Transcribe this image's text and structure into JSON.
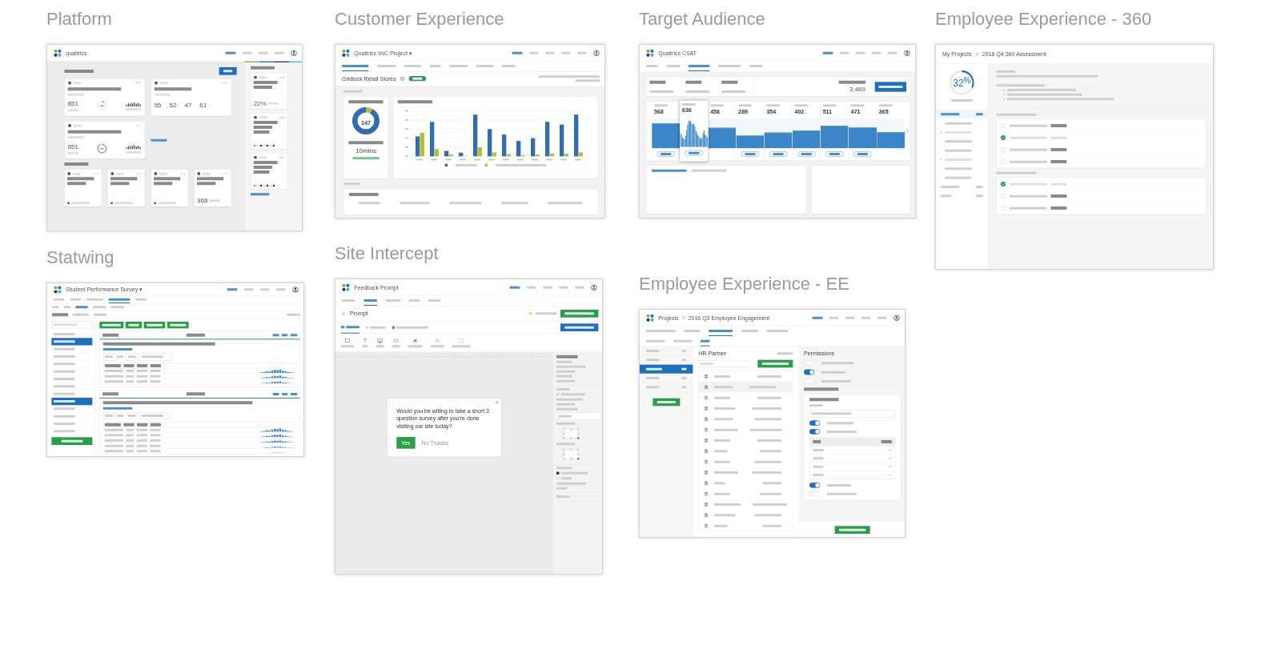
{
  "sections": [
    {
      "title": "Platform",
      "screen": {
        "kind": "platform",
        "brand": "qualtrics",
        "recent": [
          {
            "kind": "summary",
            "stat": "851"
          },
          {
            "kind": "scores",
            "scores": [
              "55",
              "52",
              "47",
              "61"
            ]
          },
          {
            "kind": "summary",
            "stat": "851"
          }
        ],
        "shared": [
          {
            "kind": "alert"
          },
          {
            "kind": "alert"
          },
          {
            "kind": "alert"
          },
          {
            "kind": "count",
            "count": "368"
          }
        ],
        "recommended": [
          {
            "kind": "stat",
            "value": "22%"
          },
          {
            "kind": "steps"
          },
          {
            "kind": "steps"
          }
        ]
      }
    },
    {
      "title": "Customer Experience",
      "screen": {
        "kind": "voc",
        "project": "Qualtrics VoC Project ▾",
        "name": "Gridlock Retail Stores",
        "total_views": "147",
        "avg_time": "10mins"
      }
    },
    {
      "title": "Target Audience",
      "screen": {
        "kind": "csat",
        "project": "Qualtrics CSAT",
        "total": "3,469",
        "months": [
          {
            "count": "568",
            "level": 0.85,
            "selected": false,
            "tagged": true
          },
          {
            "count": "636",
            "level": 0.95,
            "selected": true,
            "tagged": true
          },
          {
            "count": "458",
            "level": 0.69,
            "selected": false,
            "tagged": false
          },
          {
            "count": "289",
            "level": 0.43,
            "selected": false,
            "tagged": true
          },
          {
            "count": "354",
            "level": 0.53,
            "selected": false,
            "tagged": true
          },
          {
            "count": "402",
            "level": 0.6,
            "selected": false,
            "tagged": true
          },
          {
            "count": "511",
            "level": 0.76,
            "selected": false,
            "tagged": true
          },
          {
            "count": "471",
            "level": 0.7,
            "selected": false,
            "tagged": true
          },
          {
            "count": "365",
            "level": 0.55,
            "selected": false,
            "tagged": false
          }
        ]
      }
    },
    {
      "title": "Employee Experience - 360",
      "screen": {
        "kind": "assessment",
        "crumbs": [
          "My Projects",
          "2016 Q4 360 Assessment"
        ],
        "progress": "32$^{%}$"
      }
    },
    {
      "title": "Statwing",
      "screen": {
        "kind": "statwing",
        "project": "Student Performance Survey ▾"
      }
    },
    {
      "title": "Site Intercept",
      "screen": {
        "kind": "intercept",
        "project": "Feedback Prompt",
        "title": "Prompt",
        "popup": {
          "question": "Would you be willing to take a short 3 question survey after you're done visiting our site today?",
          "yes": "Yes",
          "no": "No Thanks"
        }
      }
    },
    {
      "title": "Employee Experience - EE",
      "screen": {
        "kind": "engagement",
        "crumbs": [
          "Projects",
          "2016 Q3 Employee Engagement"
        ],
        "list_title": "HR Partner",
        "panel_title": "Permissions"
      }
    }
  ]
}
